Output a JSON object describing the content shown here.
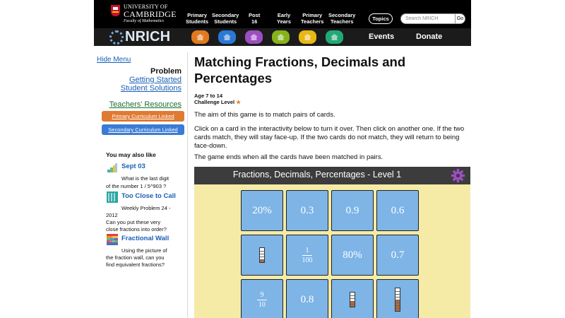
{
  "header": {
    "university_line1": "UNIVERSITY OF",
    "university_line2": "CAMBRIDGE",
    "faculty": "Faculty of Mathematics",
    "nav": [
      {
        "line1": "Primary",
        "line2": "Students"
      },
      {
        "line1": "Secondary",
        "line2": "Students"
      },
      {
        "line1": "Post",
        "line2": "16"
      },
      {
        "line1": "Early",
        "line2": "Years"
      },
      {
        "line1": "Primary",
        "line2": "Teachers"
      },
      {
        "line1": "Secondary",
        "line2": "Teachers"
      }
    ],
    "topics_label": "Topics",
    "search_placeholder": "Search NRICH",
    "go_label": "Go"
  },
  "nrich_bar": {
    "logo_text": "NRICH",
    "stage_colors": [
      "#e07a1f",
      "#2a78d4",
      "#9b4fc0",
      "#86b21c",
      "#e8b715",
      "#22a877"
    ],
    "events_label": "Events",
    "donate_label": "Donate"
  },
  "sidebar": {
    "hide_menu": "Hide Menu",
    "problem_title": "Problem",
    "getting_started": "Getting Started",
    "student_solutions": "Student Solutions",
    "teachers_resources": "Teachers' Resources",
    "primary_curriculum": {
      "label": "Primary Curriculum Linked",
      "color": "#e07a32"
    },
    "secondary_curriculum": {
      "label": "Secondary Curriculum Linked",
      "color": "#3a7bd5"
    },
    "you_may_also_like": "You may also like",
    "related": [
      {
        "title": "Sept 03",
        "desc_lines": [
          "What is the last digit",
          "of the number 1 / 5^903 ?"
        ]
      },
      {
        "title": "Too Close to Call",
        "desc_lines": [
          "Weekly Problem 24 -",
          "2012",
          "Can you put these very",
          "close fractions into order?"
        ]
      },
      {
        "title": "Fractional Wall",
        "desc_lines": [
          "Using the picture of",
          "the fraction wall, can you",
          "find equivalent fractions?"
        ]
      }
    ]
  },
  "main": {
    "title_line1": "Matching Fractions, Decimals and",
    "title_line2": "Percentages",
    "age": "Age 7 to 14",
    "challenge_label": "Challenge Level",
    "challenge_star": "★",
    "intro": "The aim of this game is to match pairs of cards.",
    "instructions": "Click on a card in the interactivity below to turn it over. Then click on another one. If the two cards match, they will stay face-up. If the two cards do not match, they will return to being face-down.",
    "ending": "The game ends when all the cards have been matched in pairs."
  },
  "game": {
    "title": "Fractions, Decimals, Percentages - Level 1",
    "cards": [
      {
        "kind": "text",
        "text": "20%"
      },
      {
        "kind": "text",
        "text": "0.3"
      },
      {
        "kind": "text",
        "text": "0.9"
      },
      {
        "kind": "text",
        "text": "0.6"
      },
      {
        "kind": "tube",
        "filled": 1,
        "total": 5
      },
      {
        "kind": "fraction",
        "numerator": "1",
        "denominator": "100"
      },
      {
        "kind": "text",
        "text": "80%"
      },
      {
        "kind": "text",
        "text": "0.7"
      },
      {
        "kind": "fraction",
        "numerator": "9",
        "denominator": "10"
      },
      {
        "kind": "text",
        "text": "0.8"
      },
      {
        "kind": "tube",
        "filled": 2,
        "total": 5
      },
      {
        "kind": "tube",
        "filled": 4,
        "total": 8
      }
    ]
  }
}
